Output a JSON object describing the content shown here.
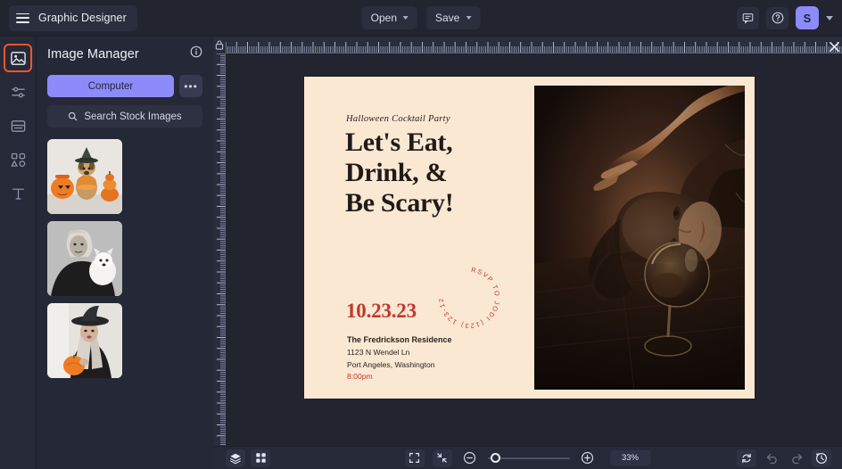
{
  "app": {
    "title": "Graphic Designer",
    "accent_purple": "#8d8bfa",
    "accent_orange": "#f2542d",
    "bar_bg": "#22242f",
    "panel_bg": "#252836"
  },
  "topbar": {
    "menu_icon": "hamburger-icon",
    "open_label": "Open",
    "save_label": "Save",
    "comment_icon": "comment-icon",
    "help_icon": "help-circle-icon",
    "avatar_initial": "S",
    "avatar_chevron_icon": "chevron-down-icon"
  },
  "rail": {
    "items": [
      {
        "name": "sidebar-item-images",
        "icon": "image-icon",
        "active": true
      },
      {
        "name": "sidebar-item-adjustments",
        "icon": "sliders-icon",
        "active": false
      },
      {
        "name": "sidebar-item-templates",
        "icon": "template-icon",
        "active": false
      },
      {
        "name": "sidebar-item-shapes",
        "icon": "shapes-icon",
        "active": false
      },
      {
        "name": "sidebar-item-text",
        "icon": "text-icon",
        "active": false
      }
    ]
  },
  "panel": {
    "title": "Image Manager",
    "info_icon": "info-icon",
    "computer_label": "Computer",
    "more_label": "•••",
    "search_label": "Search Stock Images",
    "search_icon": "search-icon",
    "thumbnails": [
      {
        "name": "thumbnail-dog-halloween-costume",
        "alt": "Dog in witch hat with pumpkin bucket"
      },
      {
        "name": "thumbnail-portrait-white-dog",
        "alt": "Black and white portrait holding white dog"
      },
      {
        "name": "thumbnail-witch-with-pumpkin",
        "alt": "Person in witch hat holding pumpkin"
      }
    ]
  },
  "canvas": {
    "lock_icon": "lock-icon",
    "close_icon": "close-icon",
    "document": {
      "background": "#fbe8d3",
      "kicker": "Halloween Cocktail Party",
      "headline": "Let's Eat, Drink, & Be Scary!",
      "date": "10.23.23",
      "venue": "The Fredrickson Residence",
      "address_line1": "1123 N Wendel Ln",
      "address_line2": "Port Angeles, Washington",
      "time": "8:00pm",
      "rsvp_circle_text": "RSVP TO JODI (123) 123-1234",
      "accent_red": "#c0392b",
      "photo_alt": "Moody dark photo of a person lying beside a wine glass"
    }
  },
  "bottombar": {
    "layers_icon": "layers-icon",
    "grid_icon": "grid-icon",
    "expand_icon": "expand-icon",
    "fit_icon": "fit-to-screen-icon",
    "zoom_out_icon": "zoom-out-icon",
    "zoom_in_icon": "zoom-in-icon",
    "zoom_value": "33%",
    "slider_percent": 8,
    "reset_icon": "reset-icon",
    "undo_icon": "undo-icon",
    "redo_icon": "redo-icon",
    "history_icon": "history-icon"
  }
}
